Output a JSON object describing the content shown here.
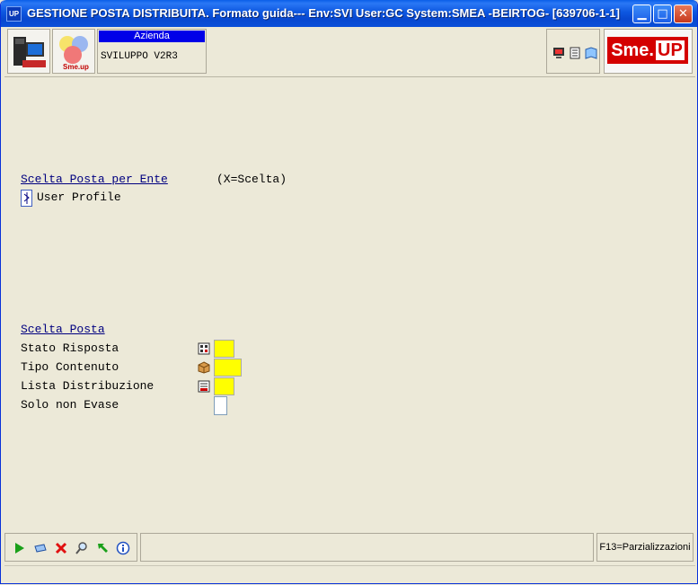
{
  "window": {
    "title": "GESTIONE POSTA DISTRIBUITA.  Formato guida--- Env:SVI User:GC System:SMEA -BEIRTOG- [639706-1-1]",
    "app_badge": "UP"
  },
  "toolbar": {
    "azienda_label": "Azienda",
    "azienda_value": "SVILUPPO V2R3",
    "brand_left": "Sme.",
    "brand_right": "UP",
    "logo_small_text": "Sme.up"
  },
  "ente": {
    "section_title": "Scelta Posta per Ente",
    "hint": "(X=Scelta)",
    "option_label": "User Profile"
  },
  "posta": {
    "section_title": "Scelta Posta",
    "fields": [
      {
        "label": "Stato Risposta",
        "value": ""
      },
      {
        "label": "Tipo Contenuto",
        "value": ""
      },
      {
        "label": "Lista Distribuzione",
        "value": ""
      },
      {
        "label": "Solo non Evase",
        "value": ""
      }
    ]
  },
  "status": {
    "function_key": "F13=Parzializzazioni"
  },
  "colors": {
    "titlebar": "#0a4fd8",
    "section_link": "#000080",
    "field_highlight": "#ffff00",
    "brand": "#d40000"
  }
}
